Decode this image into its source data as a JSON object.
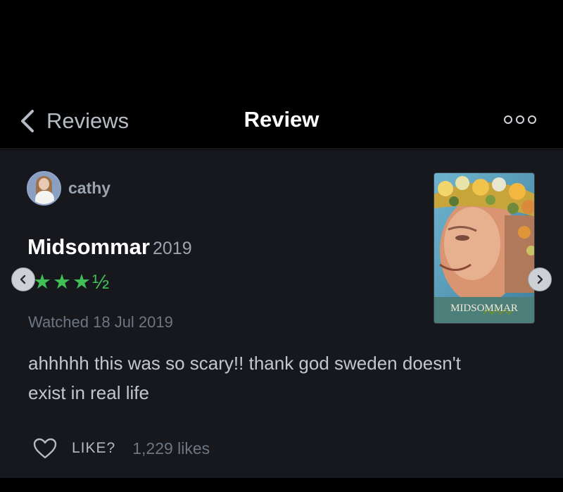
{
  "nav": {
    "back_label": "Reviews",
    "title": "Review",
    "more_icon": "more-options-icon"
  },
  "review": {
    "username": "cathy",
    "film_title": "Midsommar",
    "film_year": "2019",
    "rating_text": "★★★½",
    "rating_value": 3.5,
    "rating_max": 5,
    "watched": "Watched 18 Jul 2019",
    "text": "ahhhhh this was so scary!! thank god sweden doesn't exist in real life",
    "poster_title": "MIDSOMMAR"
  },
  "actions": {
    "like_label": "LIKE?",
    "likes_count": "1,229 likes"
  },
  "colors": {
    "background": "#16181d",
    "star_green": "#40c057",
    "nav_background": "#000000"
  }
}
